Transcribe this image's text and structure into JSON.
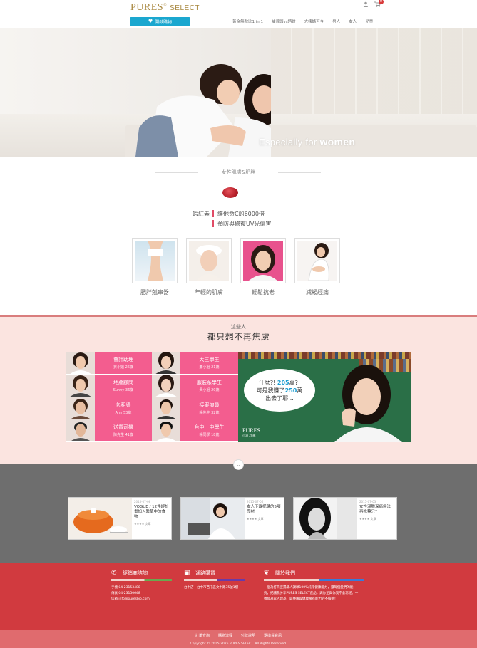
{
  "header": {
    "logo_main": "PURES",
    "logo_reg": "®",
    "logo_sub": "SELECT",
    "open_store_label": "開啟購物",
    "cart_count": "0",
    "nav": [
      "黃金無敵比1 in 1",
      "補骨頭vs鈣質",
      "大姨媽可今",
      "男人",
      "女人",
      "兒童"
    ]
  },
  "hero": {
    "tagline_light": "Especially for",
    "tagline_bold": "women"
  },
  "women": {
    "section_title": "女性肌膚&肥胖",
    "claim_label": "蝦紅素",
    "claims": [
      "維他命C的6000倍",
      "預防與修復UV光傷害"
    ],
    "features": [
      "肥胖剋串器",
      "年輕的肌膚",
      "輕鬆抗老",
      "減緩經痛"
    ]
  },
  "audience": {
    "subtitle": "這些人",
    "title": "都只想不再焦慮",
    "people": [
      {
        "role": "會計助理",
        "who": "賈小姐 26歲"
      },
      {
        "role": "大三學生",
        "who": "蕭小姐 21歲"
      },
      {
        "role": "地產顧問",
        "who": "Sunny 36歲"
      },
      {
        "role": "服裝系學生",
        "who": "黃小姐 20歲"
      },
      {
        "role": "包租婆",
        "who": "Ann 53歲"
      },
      {
        "role": "接案演員",
        "who": "楊先生 32歲"
      },
      {
        "role": "送貨司機",
        "who": "陳先生 41歲"
      },
      {
        "role": "台中一中學生",
        "who": "楊同學 18歲"
      }
    ],
    "bubble_line1": "什麼?! ",
    "bubble_hl1": "205",
    "bubble_line1b": "萬?!",
    "bubble_line2": "可是我賺了",
    "bubble_hl2": "250",
    "bubble_line2b": "萬",
    "bubble_line3": "出去了耶...",
    "board_brand": "PURES",
    "board_brand_sub": "小羽 20歲"
  },
  "articles": [
    {
      "date": "2015-07-08",
      "title": "VOGUE / 12件經計畫加入醫草中的食物",
      "meta": "文章"
    },
    {
      "date": "2015-07-06",
      "title": "女人下載把轉的5項歷材",
      "meta": "文章"
    },
    {
      "date": "2015-07-03",
      "title": "女性温腫深痛無法再吃葉只?",
      "meta": "文章"
    }
  ],
  "footer": {
    "col1_title": "經銷商諮詢",
    "col1_lines": [
      "手機 04-23153488",
      "傳真 04-23150648",
      "信箱 info@puresbio.com"
    ],
    "col2_title": "通路購買",
    "col2_lines": [
      "台中店｜台中市西屯區文中路35號1樓"
    ],
    "col3_title": "關於我們",
    "col3_lines": [
      "一個為打為宣揚讓人讚頌100%純淨健康能力，讓每個愛們的能",
      "夠，把讓我分享PURES SELECT產品，與你至與你我不會忘記。一",
      "雖能為家人理基，與樂園與健康擁有能力的不擔擠!"
    ],
    "links": [
      "訂單查詢",
      "購物流程",
      "付款說明",
      "退換貨資訊"
    ],
    "copyright": "Copyright © 2015-2025 PURES SELECT. All Rights Reserved."
  },
  "colors": {
    "accent_blue": "#1ba7cf",
    "pink_cell": "#f35d8f",
    "footer_red": "#d13a3f",
    "subfooter": "#e06b6e"
  }
}
